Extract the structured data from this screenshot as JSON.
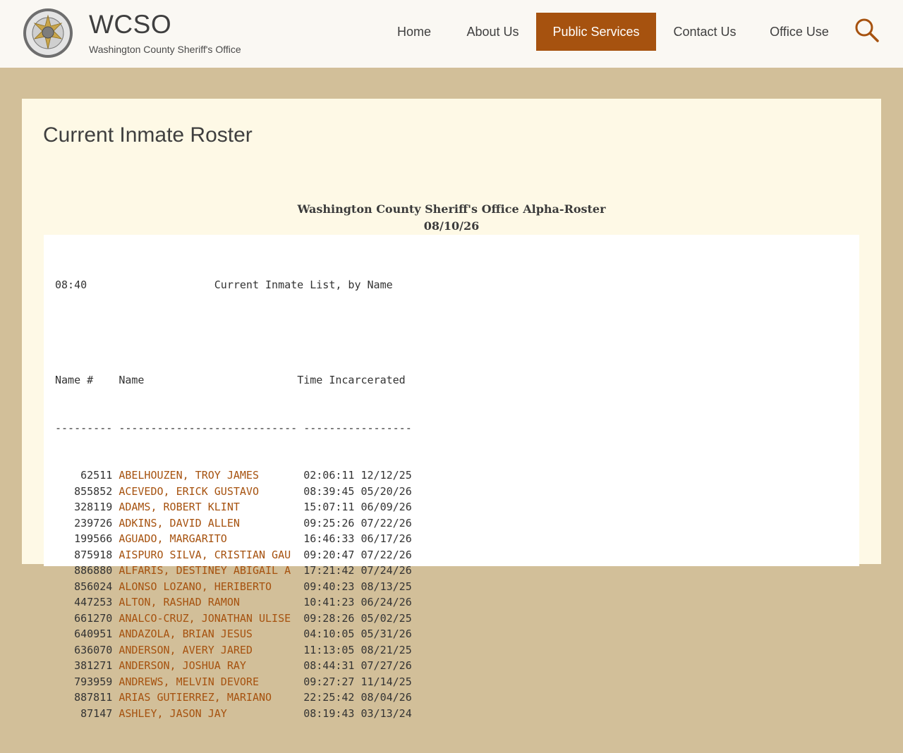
{
  "site": {
    "title": "WCSO",
    "tagline": "Washington County Sheriff's Office"
  },
  "nav": [
    {
      "label": "Home",
      "active": false
    },
    {
      "label": "About Us",
      "active": false
    },
    {
      "label": "Public Services",
      "active": true
    },
    {
      "label": "Contact Us",
      "active": false
    },
    {
      "label": "Office Use",
      "active": false
    }
  ],
  "colors": {
    "accent": "#a6520f",
    "page_bg": "#d2bf99",
    "content_bg": "#fef9e6"
  },
  "page": {
    "title": "Current Inmate Roster"
  },
  "roster": {
    "heading": "Washington County Sheriff's Office Alpha-Roster",
    "date": "08/10/26",
    "time": "08:40",
    "list_title": "Current Inmate List, by Name",
    "col_number": "Name #",
    "col_name": "Name",
    "col_time": "Time Incarcerated",
    "rule_number": "---------",
    "rule_name": "----------------------------",
    "rule_time": "-----------------",
    "rows": [
      {
        "num": "62511",
        "name": "ABELHOUZEN, TROY JAMES",
        "time": "02:06:11 12/12/25"
      },
      {
        "num": "855852",
        "name": "ACEVEDO, ERICK GUSTAVO",
        "time": "08:39:45 05/20/26"
      },
      {
        "num": "328119",
        "name": "ADAMS, ROBERT KLINT",
        "time": "15:07:11 06/09/26"
      },
      {
        "num": "239726",
        "name": "ADKINS, DAVID ALLEN",
        "time": "09:25:26 07/22/26"
      },
      {
        "num": "199566",
        "name": "AGUADO, MARGARITO",
        "time": "16:46:33 06/17/26"
      },
      {
        "num": "875918",
        "name": "AISPURO SILVA, CRISTIAN GAU",
        "time": "09:20:47 07/22/26"
      },
      {
        "num": "886880",
        "name": "ALFARIS, DESTINEY ABIGAIL A",
        "time": "17:21:42 07/24/26"
      },
      {
        "num": "856024",
        "name": "ALONSO LOZANO, HERIBERTO",
        "time": "09:40:23 08/13/25"
      },
      {
        "num": "447253",
        "name": "ALTON, RASHAD RAMON",
        "time": "10:41:23 06/24/26"
      },
      {
        "num": "661270",
        "name": "ANALCO-CRUZ, JONATHAN ULISE",
        "time": "09:28:26 05/02/25"
      },
      {
        "num": "640951",
        "name": "ANDAZOLA, BRIAN JESUS",
        "time": "04:10:05 05/31/26"
      },
      {
        "num": "636070",
        "name": "ANDERSON, AVERY JARED",
        "time": "11:13:05 08/21/25"
      },
      {
        "num": "381271",
        "name": "ANDERSON, JOSHUA RAY",
        "time": "08:44:31 07/27/26"
      },
      {
        "num": "793959",
        "name": "ANDREWS, MELVIN DEVORE",
        "time": "09:27:27 11/14/25"
      },
      {
        "num": "887811",
        "name": "ARIAS GUTIERREZ, MARIANO",
        "time": "22:25:42 08/04/26"
      },
      {
        "num": "87147",
        "name": "ASHLEY, JASON JAY",
        "time": "08:19:43 03/13/24"
      }
    ]
  }
}
